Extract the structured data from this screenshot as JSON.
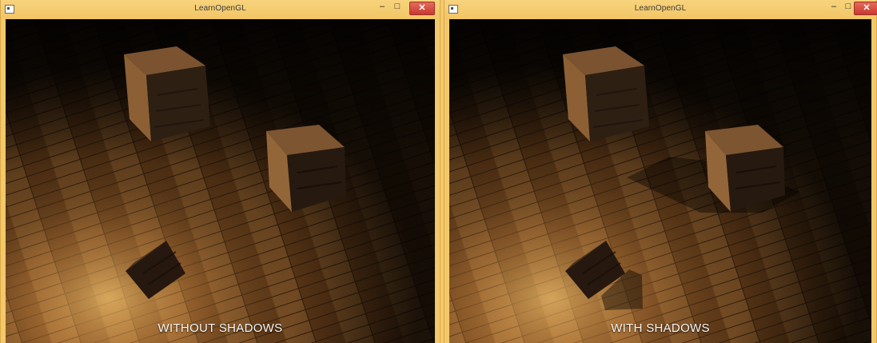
{
  "windows": [
    {
      "title": "LearnOpenGL",
      "caption": "WITHOUT SHADOWS",
      "controls": {
        "minimize": "‒",
        "maximize": "□",
        "close": "✕"
      }
    },
    {
      "title": "LearnOpenGL",
      "caption": "WITH SHADOWS",
      "controls": {
        "minimize": "‒",
        "maximize": "□",
        "close": "✕"
      }
    }
  ],
  "colors": {
    "window_frame": "#f3c86b",
    "close_button": "#d24b3e",
    "caption_text": "#f5f5f5"
  }
}
